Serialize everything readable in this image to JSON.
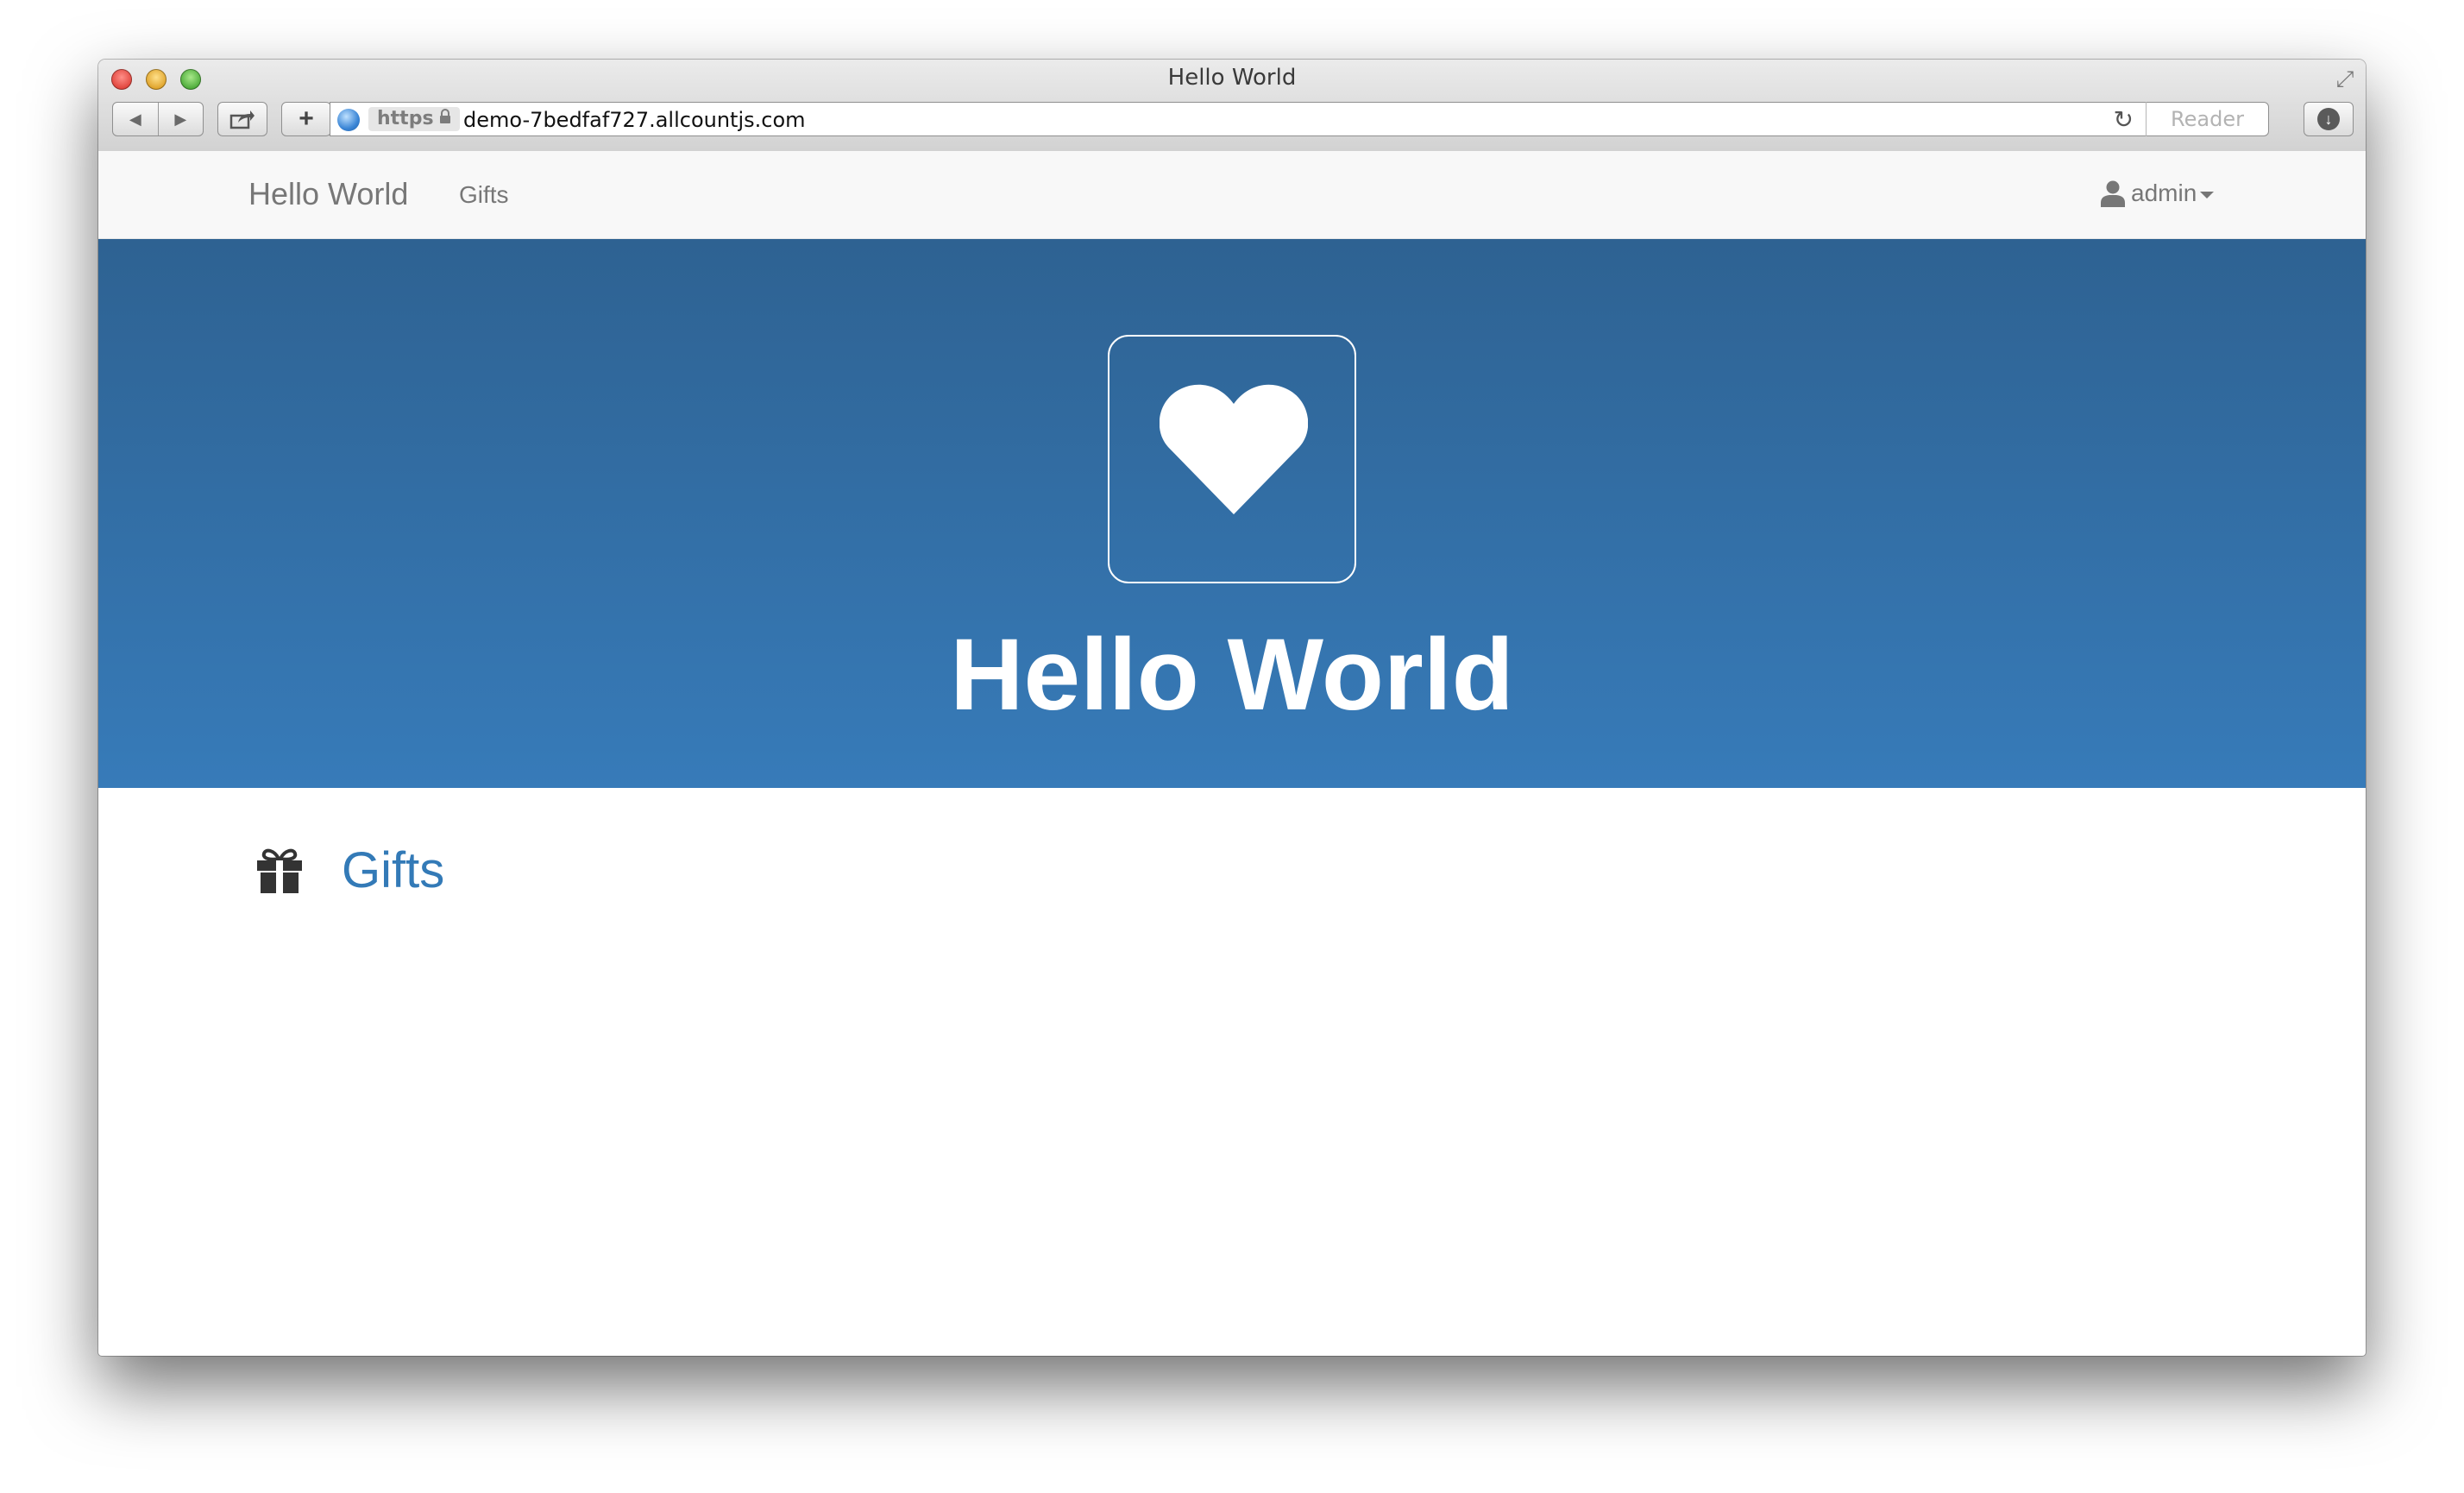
{
  "browser": {
    "window_title": "Hello World",
    "url_scheme": "https",
    "url": "demo-7bedfaf727.allcountjs.com",
    "reader_label": "Reader",
    "icons": [
      "back-icon",
      "forward-icon",
      "share-icon",
      "new-tab-icon",
      "globe-icon",
      "lock-icon",
      "reload-icon",
      "download-icon",
      "fullscreen-icon"
    ]
  },
  "navbar": {
    "brand": "Hello World",
    "links": [
      {
        "label": "Gifts"
      }
    ],
    "user": {
      "label": "admin",
      "icon": "user-icon"
    }
  },
  "hero": {
    "icon": "heart-icon",
    "title": "Hello World"
  },
  "menu": {
    "items": [
      {
        "label": "Gifts",
        "icon": "gift-icon"
      }
    ]
  },
  "colors": {
    "hero_top": "#2e6292",
    "hero_bottom": "#377bb9",
    "link": "#337ab7",
    "navbar_bg": "#f8f8f8",
    "navbar_text": "#777777"
  }
}
